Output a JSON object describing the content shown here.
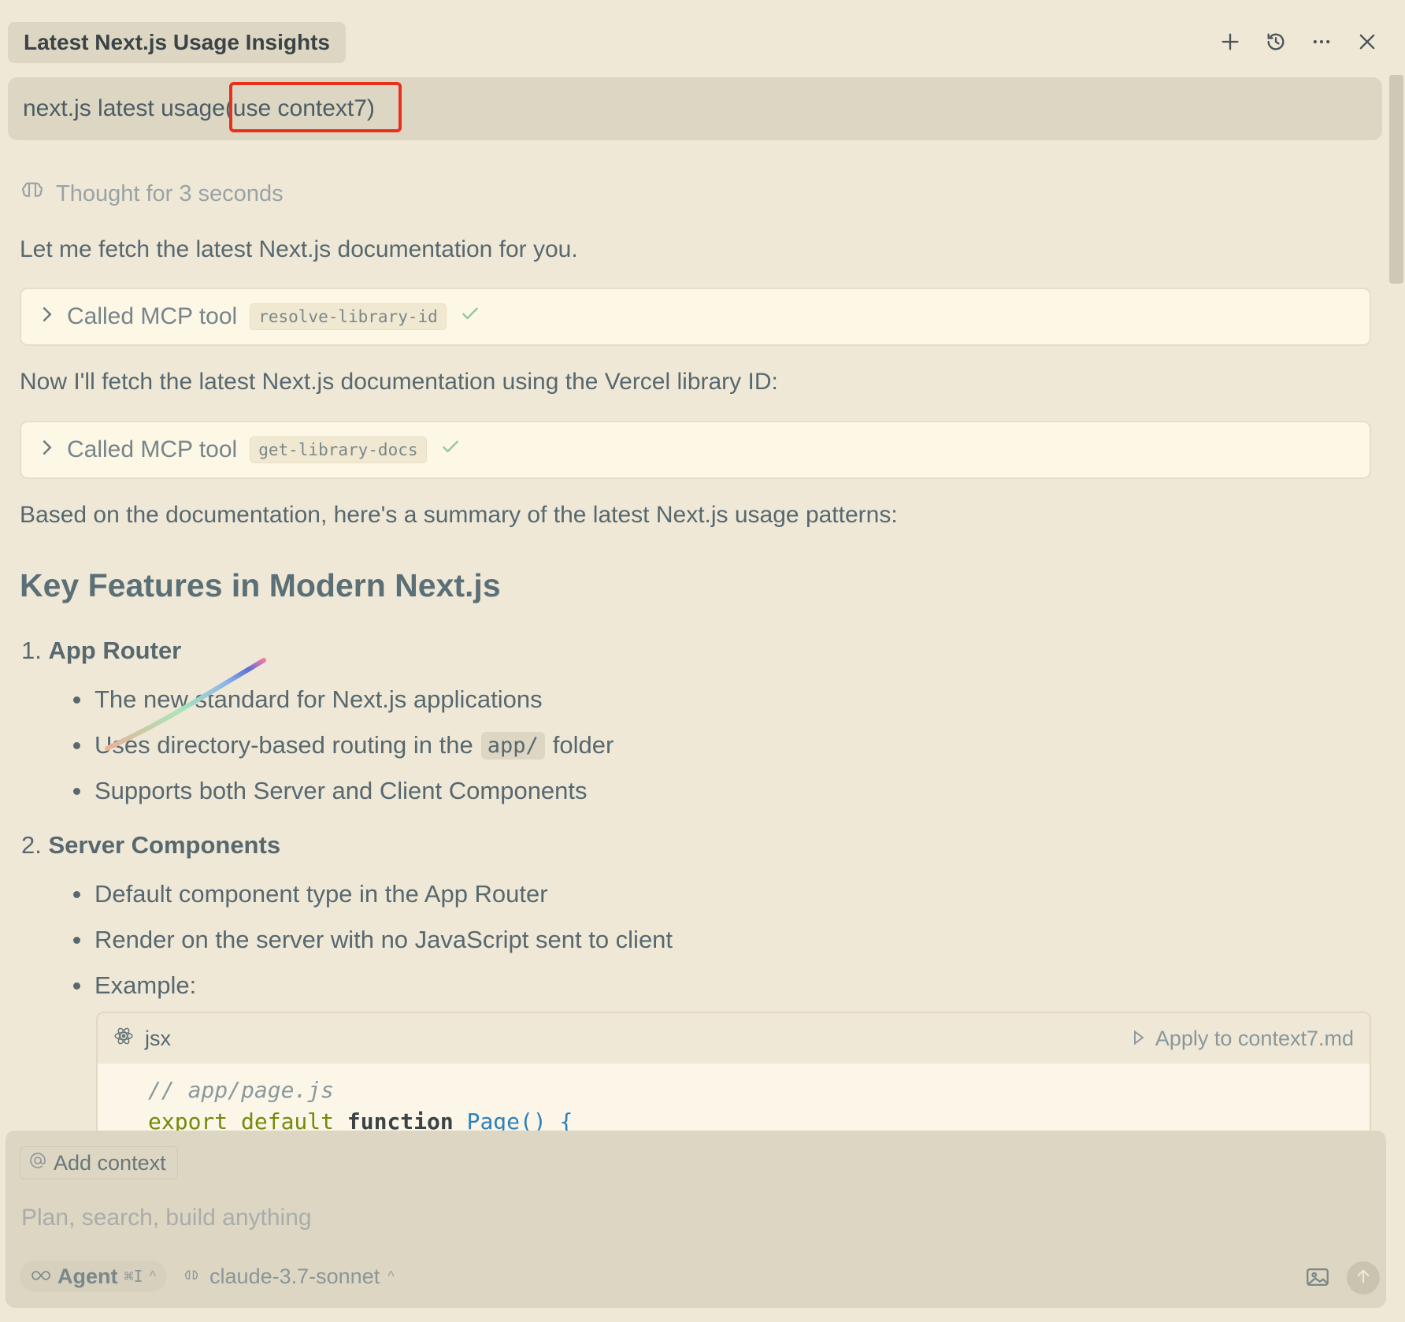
{
  "header": {
    "tab_title": "Latest Next.js Usage Insights",
    "icons": [
      "plus-icon",
      "history-icon",
      "more-icon",
      "close-icon"
    ]
  },
  "user_message": {
    "text": "next.js latest usage(use context7)"
  },
  "thought": {
    "label": "Thought for 3 seconds"
  },
  "messages": {
    "intro": "Let me fetch the latest Next.js documentation for you.",
    "tool1": {
      "label": "Called MCP tool",
      "tool": "resolve-library-id"
    },
    "middle": "Now I'll fetch the latest Next.js documentation using the Vercel library ID:",
    "tool2": {
      "label": "Called MCP tool",
      "tool": "get-library-docs"
    },
    "summary": "Based on the documentation, here's a summary of the latest Next.js usage patterns:"
  },
  "content": {
    "heading": "Key Features in Modern Next.js",
    "items": [
      {
        "number": "1.",
        "title": "App Router",
        "bullets": [
          "The new standard for Next.js applications",
          "Uses directory-based routing in the",
          "Supports both Server and Client Components"
        ],
        "inline_code": "app/",
        "inline_suffix": "folder"
      },
      {
        "number": "2.",
        "title": "Server Components",
        "bullets": [
          "Default component type in the App Router",
          "Render on the server with no JavaScript sent to client",
          "Example:"
        ]
      }
    ]
  },
  "code_block": {
    "language": "jsx",
    "apply_label": "Apply to context7.md",
    "line1": "// app/page.js",
    "line2_kw": "export default",
    "line2_fn_kw": "function",
    "line2_name": "Page",
    "line2_rest": "() {"
  },
  "input": {
    "add_context": "Add context",
    "placeholder": "Plan, search, build anything",
    "mode": "Agent",
    "mode_shortcut": "⌘I",
    "model": "claude-3.7-sonnet"
  },
  "colors": {
    "background": "#efe8d7",
    "panel": "#dcd6c3",
    "highlight_box": "#e8301c",
    "check": "#8fc9a0"
  }
}
